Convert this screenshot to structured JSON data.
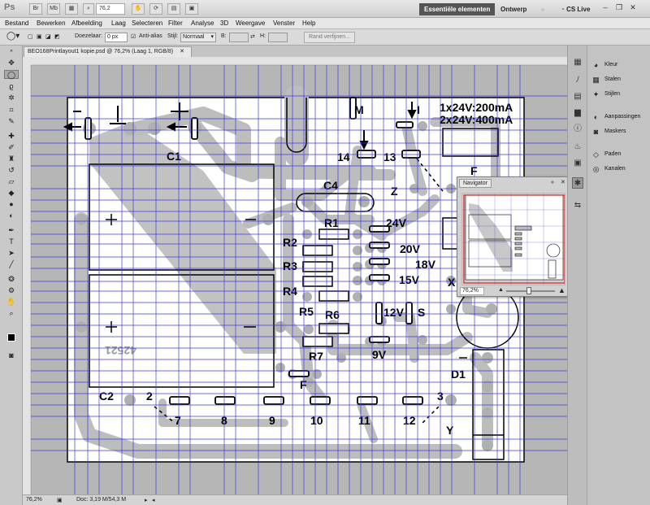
{
  "app": {
    "logo": "Ps",
    "zoom": "76,2",
    "workspace_active": "Essentiële elementen",
    "workspace_other": "Ontwerp",
    "cs_live": "CS Live"
  },
  "menu": [
    "Bestand",
    "Bewerken",
    "Afbeelding",
    "Laag",
    "Selecteren",
    "Filter",
    "Analyse",
    "3D",
    "Weergave",
    "Venster",
    "Help"
  ],
  "options": {
    "feather_label": "Doezelaar:",
    "feather_value": "0 px",
    "antialias_label": "Anti-alias",
    "style_label": "Stijl:",
    "style_value": "Normaal",
    "width_label": "B:",
    "height_label": "H:",
    "refine_button": "Rand verfijnen..."
  },
  "document": {
    "tab_title": "BEO168Printlayout1 kopie.psd @ 76,2% (Laag 1, RGB/8)",
    "zoom_status": "76,2%",
    "doc_status": "Doc: 3,19 M/54,3 M"
  },
  "pcb": {
    "labels": {
      "c1": "C1",
      "c2": "C2",
      "c4": "C4",
      "r1": "R1",
      "r2": "R2",
      "r3": "R3",
      "r4": "R4",
      "r5": "R5",
      "r6": "R6",
      "r7": "R7",
      "m": "M",
      "i": "I",
      "f": "F",
      "f2": "F",
      "z": "Z",
      "x": "X",
      "y": "Y",
      "s": "S",
      "d1": "D1",
      "v24": "24V",
      "v20": "20V",
      "v18": "18V",
      "v15": "15V",
      "v12": "12V",
      "v9": "9V",
      "p14": "14",
      "p13": "13",
      "p2": "2",
      "p3": "3",
      "p7": "7",
      "p8": "8",
      "p9": "9",
      "p10": "10",
      "p11": "11",
      "p12": "12",
      "spec1": "1x24V:200mA",
      "spec2": "2x24V:400mA",
      "code": "42521",
      "minus": "−",
      "plus": "+"
    }
  },
  "navigator": {
    "title": "Navigator",
    "zoom": "76,2%"
  },
  "panels": [
    {
      "label": "Kleur",
      "icon": "color-icon"
    },
    {
      "label": "Stalen",
      "icon": "swatches-icon"
    },
    {
      "label": "Stijlen",
      "icon": "styles-icon"
    },
    {
      "label": "Aanpassingen",
      "icon": "adjustments-icon"
    },
    {
      "label": "Maskers",
      "icon": "masks-icon"
    },
    {
      "label": "Paden",
      "icon": "paths-icon"
    },
    {
      "label": "Kanalen",
      "icon": "channels-icon"
    }
  ]
}
